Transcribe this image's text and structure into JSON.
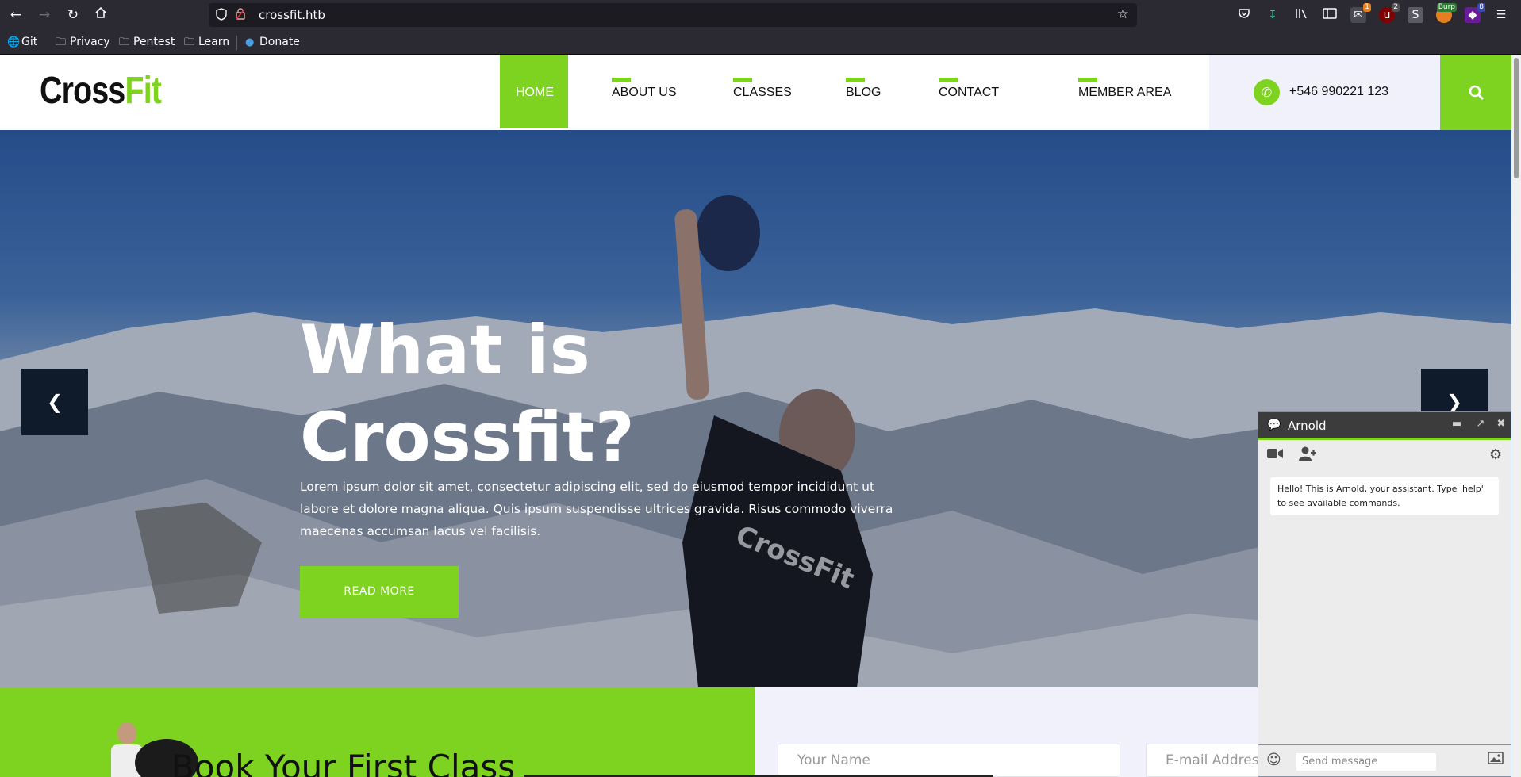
{
  "browser": {
    "url": "crossfit.htb",
    "bookmarks": [
      "Git",
      "Privacy",
      "Pentest",
      "Learn",
      "Donate"
    ],
    "extension_badges": {
      "b1": "1",
      "b2": "2",
      "b3": "Burp",
      "b4": "8"
    }
  },
  "site": {
    "logo": {
      "part1": "Cross",
      "part2": "Fit"
    },
    "nav": [
      "HOME",
      "ABOUT US",
      "CLASSES",
      "BLOG",
      "CONTACT",
      "MEMBER AREA"
    ],
    "phone": "+546 990221 123"
  },
  "hero": {
    "title_line1": "What is",
    "title_line2": "Crossfit?",
    "text": "Lorem ipsum dolor sit amet, consectetur adipiscing elit, sed do eiusmod tempor incididunt ut labore et dolore magna aliqua. Quis ipsum suspendisse ultrices gravida. Risus commodo viverra maecenas accumsan lacus vel facilisis.",
    "button": "READ MORE"
  },
  "booking": {
    "title": "Book Your First Class",
    "name_placeholder": "Your Name",
    "email_placeholder": "E-mail Address"
  },
  "chat": {
    "agent_name": "Arnold",
    "message": "Hello! This is Arnold, your assistant. Type 'help' to see available commands.",
    "input_placeholder": "Send message"
  },
  "colors": {
    "accent": "#7ed321",
    "dark": "#111111",
    "browser_bg": "#2b2a33"
  }
}
